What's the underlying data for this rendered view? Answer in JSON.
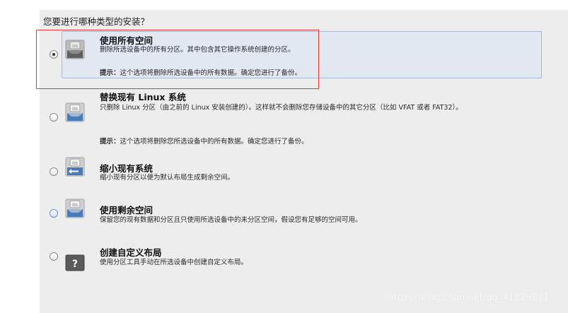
{
  "question": "您要进行哪种类型的安装？",
  "options": [
    {
      "title": "使用所有空间",
      "description": "删除所选设备中的所有分区。其中包含其它操作系统创建的分区。",
      "hint_label": "提示：",
      "hint_text": "这个选项将删除所选设备中的所有数据。确定您进行了备份。",
      "icon": "os-full-disk-icon",
      "selected": true
    },
    {
      "title": "替换现有 Linux 系统",
      "description": "只删除 Linux 分区（由之前的 Linux 安装创建的）。这样就不会删除您存储设备中的其它分区（比如 VFAT 或者 FAT32）。",
      "hint_label": "提示：",
      "hint_text": "这个选项将删除您所选设备中的所有数据。确定您进行了备份。",
      "icon": "os-replace-linux-icon",
      "selected": false
    },
    {
      "title": "缩小现有系统",
      "description": "缩小现有分区以便为默认布局生成剩余空间。",
      "icon": "os-shrink-icon",
      "selected": false
    },
    {
      "title": "使用剩余空间",
      "description": "保留您的现有数据和分区且只使用所选设备中的未分区空间，假设您有足够的空间可用。",
      "icon": "os-free-space-icon",
      "selected": false
    },
    {
      "title": "创建自定义布局",
      "description": "使用分区工具手动在所选设备中创建自定义布局。",
      "icon": "custom-layout-question-icon",
      "selected": false
    }
  ],
  "icon_label": "OS",
  "custom_icon_glyph": "?",
  "watermark": "https://blog.csdn.net/qq_41129811",
  "colors": {
    "panel_bg": "#ededed",
    "selected_bg": "#e2e8f2",
    "highlight_box": "#e53935",
    "icon_blue": "#4a7ab8"
  }
}
